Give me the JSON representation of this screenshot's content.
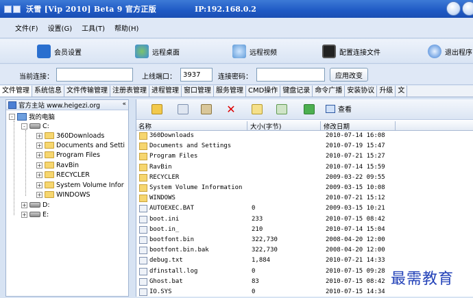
{
  "window": {
    "title": "沃雪 [Vip 2010] Beta 9 官方正版",
    "ip_label": "IP:192.168.0.2"
  },
  "menu": [
    "文件(F)",
    "设置(G)",
    "工具(T)",
    "帮助(H)"
  ],
  "toolbar": {
    "member": "会员设置",
    "remote_desktop": "远程桌面",
    "remote_video": "远程视频",
    "config_file": "配置连接文件",
    "exit": "退出程序"
  },
  "connection": {
    "current_label": "当前连接：",
    "current_value": "",
    "port_label": "上线端口：",
    "port_value": "3937",
    "password_label": "连接密码：",
    "password_value": "",
    "apply_label": "应用改变"
  },
  "tabs": [
    "文件管理",
    "系统信息",
    "文件传输管理",
    "注册表管理",
    "进程管理",
    "窗口管理",
    "服务管理",
    "CMD操作",
    "键盘记录",
    "命令广播",
    "安装协议",
    "升级",
    "文"
  ],
  "tree": {
    "header": "官方主站 www.heigezi.org",
    "collapse": "«",
    "root": "我的电脑",
    "drive_c": "C:",
    "folders": [
      "360Downloads",
      "Documents and Setti",
      "Program Files",
      "RavBin",
      "RECYCLER",
      "System Volume Infor",
      "WINDOWS"
    ],
    "drive_d": "D:",
    "drive_e": "E:",
    "expand": "+",
    "collapse_sign": "-"
  },
  "filelist": {
    "view_label": "查看",
    "columns": [
      "名称",
      "大小(字节)",
      "修改日期"
    ],
    "rows": [
      {
        "name": "360Downloads",
        "size": "",
        "date": "2010-07-14 16:08",
        "type": "folder"
      },
      {
        "name": "Documents and Settings",
        "size": "",
        "date": "2010-07-19 15:47",
        "type": "folder"
      },
      {
        "name": "Program Files",
        "size": "",
        "date": "2010-07-21 15:27",
        "type": "folder"
      },
      {
        "name": "RavBin",
        "size": "",
        "date": "2010-07-14 15:59",
        "type": "folder"
      },
      {
        "name": "RECYCLER",
        "size": "",
        "date": "2009-03-22 09:55",
        "type": "folder"
      },
      {
        "name": "System Volume Information",
        "size": "",
        "date": "2009-03-15 10:08",
        "type": "folder"
      },
      {
        "name": "WINDOWS",
        "size": "",
        "date": "2010-07-21 15:12",
        "type": "folder"
      },
      {
        "name": "AUTOEXEC.BAT",
        "size": "0",
        "date": "2009-03-15 10:21",
        "type": "file"
      },
      {
        "name": "boot.ini",
        "size": "233",
        "date": "2010-07-15 08:42",
        "type": "file"
      },
      {
        "name": "boot.in_",
        "size": "210",
        "date": "2010-07-14 15:04",
        "type": "file"
      },
      {
        "name": "bootfont.bin",
        "size": "322,730",
        "date": "2008-04-20 12:00",
        "type": "file"
      },
      {
        "name": "bootfont.bin.bak",
        "size": "322,730",
        "date": "2008-04-20 12:00",
        "type": "file"
      },
      {
        "name": "debug.txt",
        "size": "1,884",
        "date": "2010-07-21 14:33",
        "type": "file"
      },
      {
        "name": "dfinstall.log",
        "size": "0",
        "date": "2010-07-15 09:28",
        "type": "file"
      },
      {
        "name": "Ghost.bat",
        "size": "83",
        "date": "2010-07-15 08:42",
        "type": "file"
      },
      {
        "name": "IO.SYS",
        "size": "0",
        "date": "2010-07-15 14:34",
        "type": "file"
      }
    ]
  },
  "watermark": "最需教育"
}
